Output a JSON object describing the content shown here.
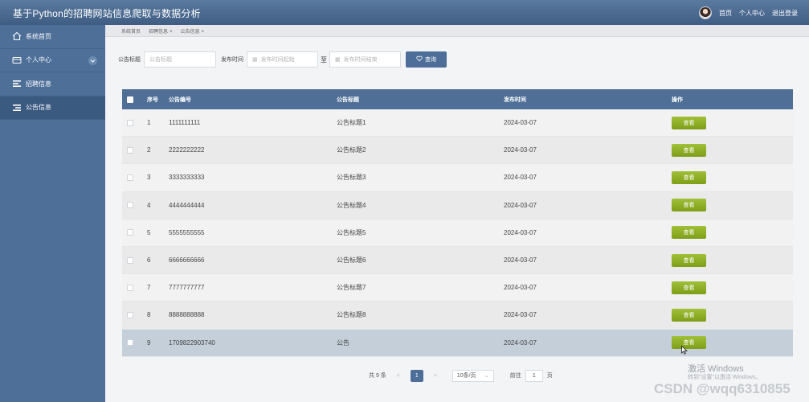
{
  "header": {
    "app_title": "基于Python的招聘网站信息爬取与数据分析",
    "links": [
      "首页",
      "个人中心",
      "退出登录"
    ]
  },
  "sidebar": {
    "items": [
      {
        "label": "系统首页",
        "icon": "home-icon"
      },
      {
        "label": "个人中心",
        "icon": "profile-card-icon",
        "expandable": true
      },
      {
        "label": "招聘信息",
        "icon": "list-icon"
      },
      {
        "label": "公告信息",
        "icon": "list-icon",
        "active": true
      }
    ]
  },
  "tabs": [
    {
      "label": "系统首页",
      "closable": false
    },
    {
      "label": "招聘信息",
      "closable": true
    },
    {
      "label": "公告信息",
      "closable": true
    }
  ],
  "filters": {
    "title_label": "公告标题",
    "title_placeholder": "公告标题",
    "time_label": "发布时间",
    "start_placeholder": "发布时间起始",
    "to_label": "至",
    "end_placeholder": "发布时间结束",
    "query_button": "查询"
  },
  "table": {
    "columns": [
      "序号",
      "公告编号",
      "公告标题",
      "发布时间",
      "操作"
    ],
    "rows": [
      {
        "idx": "1",
        "code": "1111111111",
        "title": "公告标题1",
        "time": "2024-03-07",
        "action": "查看"
      },
      {
        "idx": "2",
        "code": "2222222222",
        "title": "公告标题2",
        "time": "2024-03-07",
        "action": "查看"
      },
      {
        "idx": "3",
        "code": "3333333333",
        "title": "公告标题3",
        "time": "2024-03-07",
        "action": "查看"
      },
      {
        "idx": "4",
        "code": "4444444444",
        "title": "公告标题4",
        "time": "2024-03-07",
        "action": "查看"
      },
      {
        "idx": "5",
        "code": "5555555555",
        "title": "公告标题5",
        "time": "2024-03-07",
        "action": "查看"
      },
      {
        "idx": "6",
        "code": "6666666666",
        "title": "公告标题6",
        "time": "2024-03-07",
        "action": "查看"
      },
      {
        "idx": "7",
        "code": "7777777777",
        "title": "公告标题7",
        "time": "2024-03-07",
        "action": "查看"
      },
      {
        "idx": "8",
        "code": "8888888888",
        "title": "公告标题8",
        "time": "2024-03-07",
        "action": "查看"
      },
      {
        "idx": "9",
        "code": "1709822903740",
        "title": "公告",
        "time": "2024-03-07",
        "action": "查看"
      }
    ]
  },
  "pagination": {
    "total": "共 9 条",
    "prev": "<",
    "current_page": "1",
    "next": ">",
    "page_size": "10条/页",
    "goto_label": "前往",
    "goto_value": "1",
    "goto_unit": "页"
  },
  "watermarks": {
    "activate_title": "激活 Windows",
    "activate_sub": "转到\"设置\"以激活 Windows。",
    "csdn": "CSDN @wqq6310855"
  },
  "colors": {
    "header_bg": "#4b6b92",
    "sidebar_bg": "#4d6f98",
    "accent_button": "#4d6e99",
    "view_button": "#8fb02a",
    "highlight_row": "#c4cfd9"
  }
}
